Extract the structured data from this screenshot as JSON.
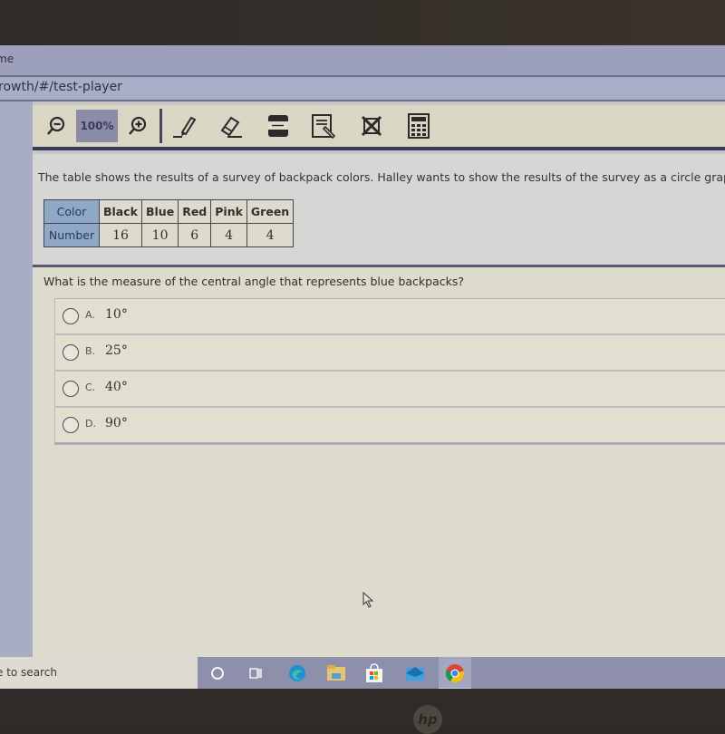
{
  "browser": {
    "tab_title_fragment": "me",
    "url_fragment": "rowth/#/test-player"
  },
  "toolbar": {
    "zoom_out_icon": "zoom-out-icon",
    "zoom_level": "100%",
    "zoom_in_icon": "zoom-in-icon",
    "tools": [
      {
        "name": "highlighter-icon"
      },
      {
        "name": "eraser-icon"
      },
      {
        "name": "line-reader-icon"
      },
      {
        "name": "notepad-icon"
      },
      {
        "name": "answer-eliminator-icon"
      },
      {
        "name": "calculator-icon"
      }
    ]
  },
  "passage": {
    "text": "The table shows the results of a survey of backpack colors. Halley wants to show the results of the survey as a circle graph.",
    "table": {
      "row_labels": [
        "Color",
        "Number"
      ],
      "colors": [
        "Black",
        "Blue",
        "Red",
        "Pink",
        "Green"
      ],
      "numbers": [
        "16",
        "10",
        "6",
        "4",
        "4"
      ]
    }
  },
  "question": {
    "text": "What is the measure of the central angle that represents blue backpacks?",
    "choices": [
      {
        "letter": "A.",
        "value": "10°"
      },
      {
        "letter": "B.",
        "value": "25°"
      },
      {
        "letter": "C.",
        "value": "40°"
      },
      {
        "letter": "D.",
        "value": "90°"
      }
    ]
  },
  "taskbar": {
    "search_placeholder": "e to search",
    "icons": [
      "cortana-icon",
      "task-view-icon",
      "edge-icon",
      "file-explorer-icon",
      "store-icon",
      "mail-icon",
      "chrome-icon"
    ]
  },
  "device": {
    "logo": "hp"
  }
}
